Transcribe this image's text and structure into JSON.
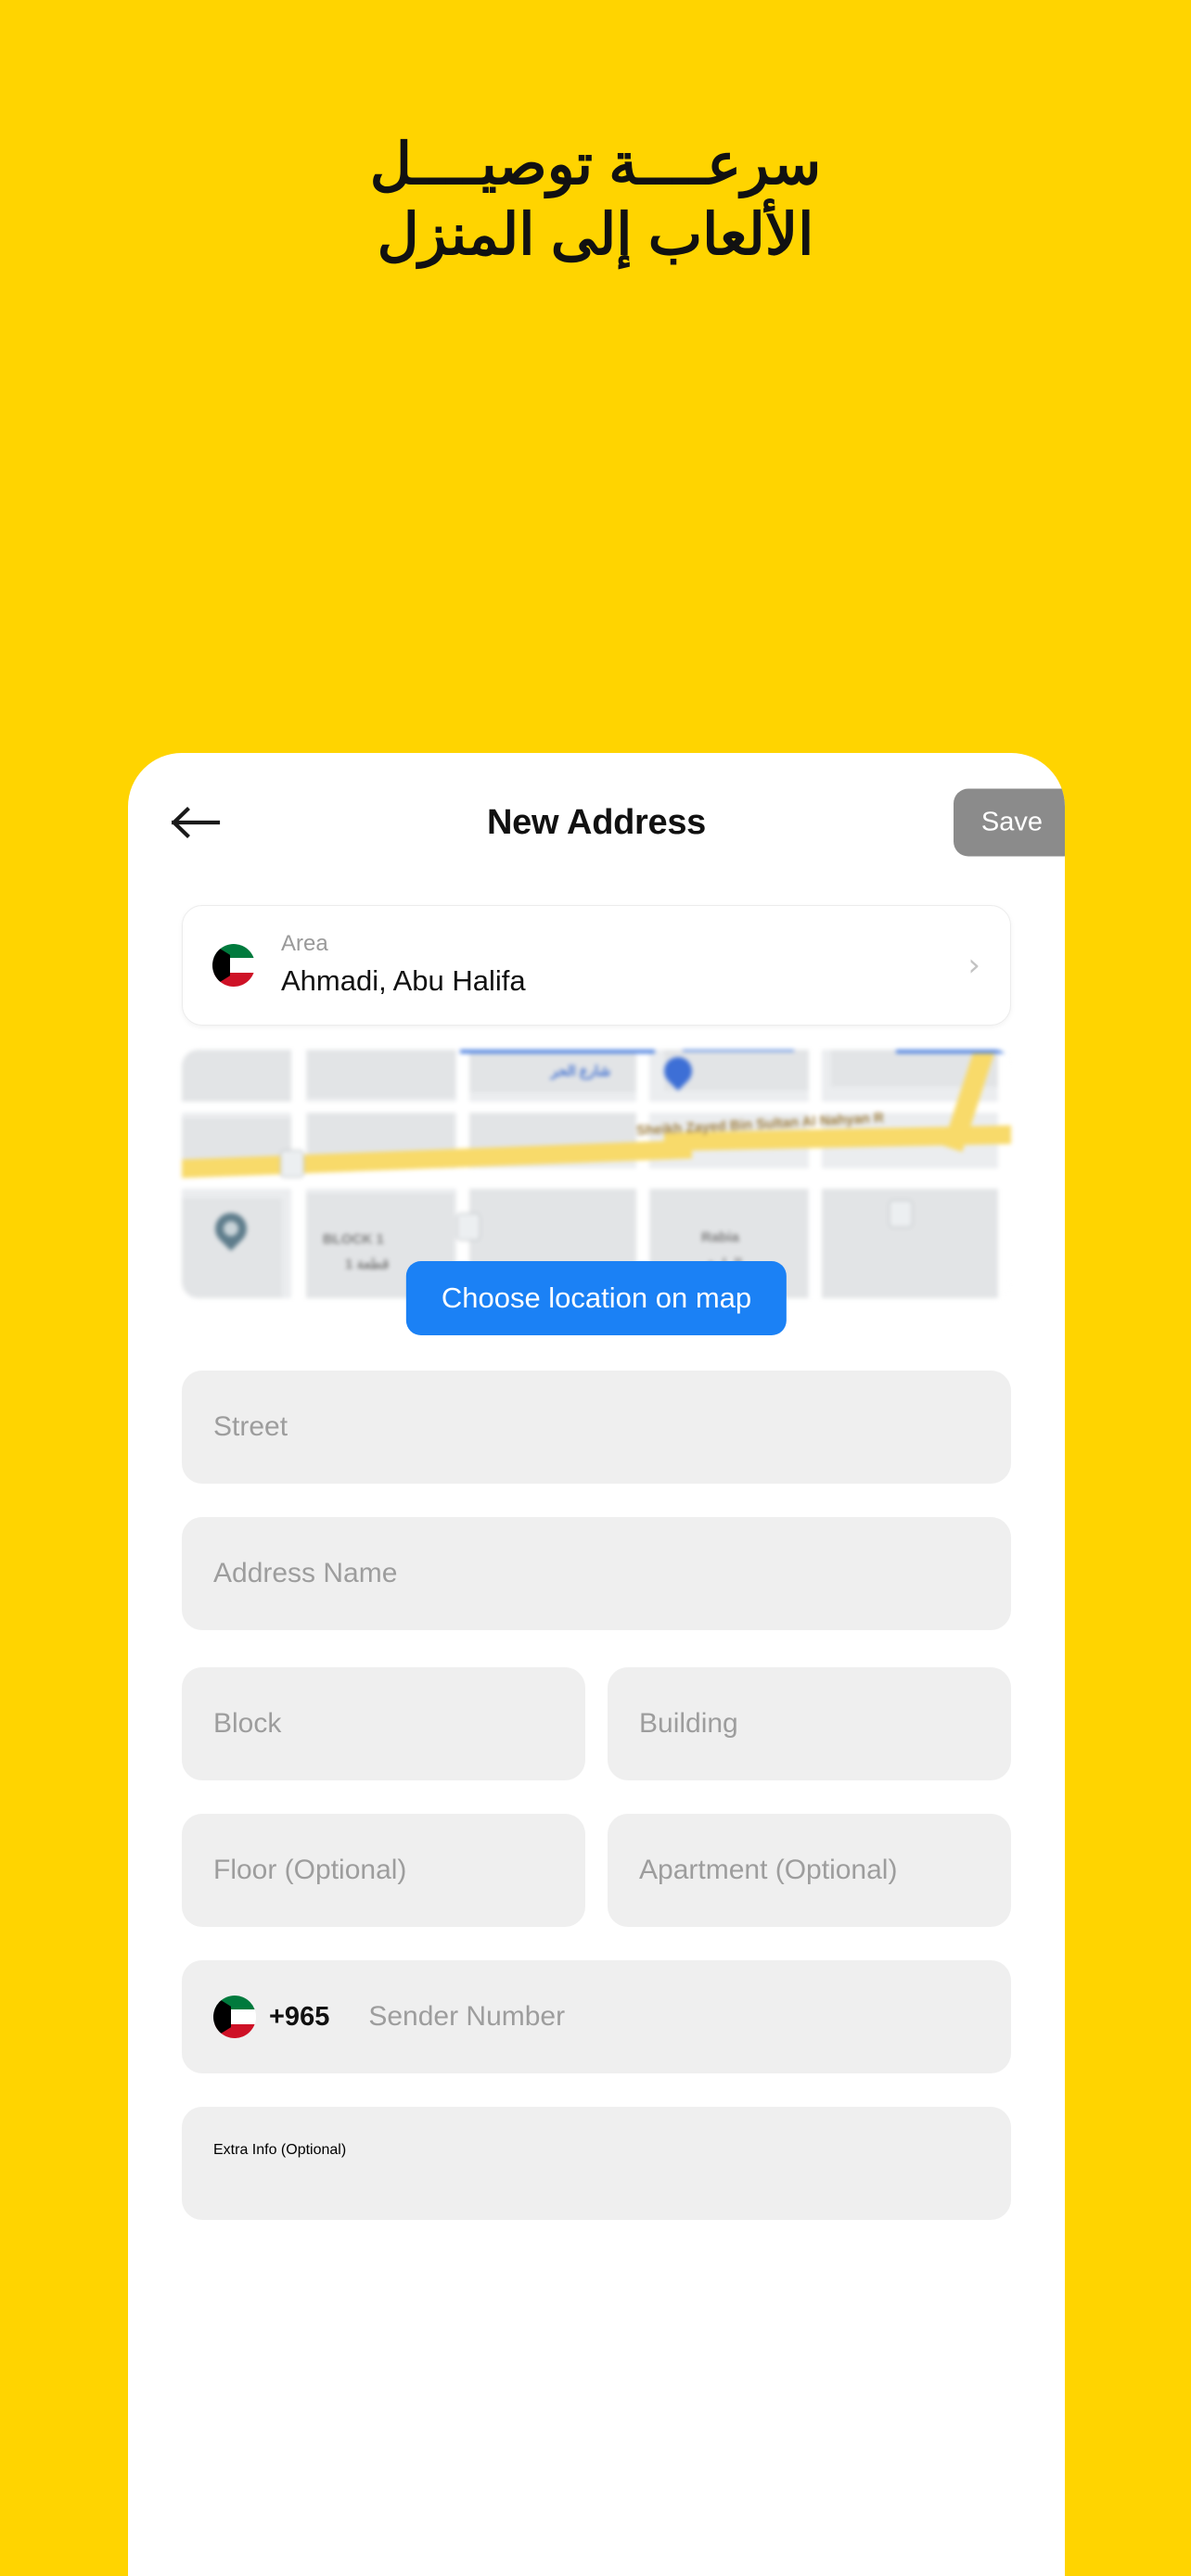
{
  "promo": {
    "line1": "سرعــــة توصيــــل",
    "line2": "الألعاب إلى المنزل",
    "background_color": "#FFD400",
    "text_color": "#111111"
  },
  "appbar": {
    "back_icon": "arrow-left-icon",
    "title": "New Address",
    "save_label": "Save",
    "save_color": "#8b8b8b"
  },
  "area_card": {
    "flag_icon": "kuwait-flag-icon",
    "label": "Area",
    "value": "Ahmadi, Abu Halifa",
    "chevron": "›"
  },
  "map": {
    "choose_button_label": "Choose location on map",
    "choose_button_color": "#1b81f5",
    "labels": [
      {
        "text": "Sheikh Zayed Bin Sultan Al Nahyan R",
        "style": "brown"
      },
      {
        "text": "BLOCK 1",
        "style": "dark"
      },
      {
        "text": "1 قطعة",
        "style": "dark"
      },
      {
        "text": "Rabia",
        "style": "dark"
      },
      {
        "text": "الرابية",
        "style": "dark"
      },
      {
        "text": "شارع الحر",
        "style": "blue"
      }
    ]
  },
  "form": {
    "street": {
      "placeholder": "Street",
      "value": ""
    },
    "address_name": {
      "placeholder": "Address Name",
      "value": ""
    },
    "block": {
      "placeholder": "Block",
      "value": ""
    },
    "building": {
      "placeholder": "Building",
      "value": ""
    },
    "floor": {
      "placeholder": "Floor (Optional)",
      "value": ""
    },
    "apartment": {
      "placeholder": "Apartment (Optional)",
      "value": ""
    },
    "phone": {
      "flag_icon": "kuwait-flag-icon",
      "country_code": "+965",
      "placeholder": "Sender Number",
      "value": ""
    },
    "extra_info": {
      "placeholder": "Extra Info (Optional)",
      "value": ""
    }
  }
}
